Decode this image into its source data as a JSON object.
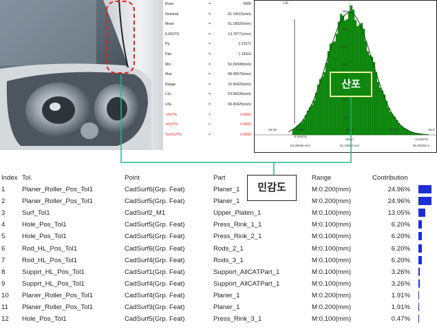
{
  "stats": [
    {
      "label": "Runs",
      "value": "5000",
      "red": false
    },
    {
      "label": "Nominal",
      "value": "61.16515(mm)",
      "red": false
    },
    {
      "label": "Mean",
      "value": "61.18920(mm)",
      "red": false
    },
    {
      "label": "6.00STD",
      "value": "13.79771(mm)",
      "red": false
    },
    {
      "label": "Pp",
      "value": "1.21571",
      "red": false
    },
    {
      "label": "Ppk",
      "value": "1.18110",
      "red": false
    },
    {
      "label": "Min",
      "value": "52.09349(mm)",
      "red": false
    },
    {
      "label": "Max",
      "value": "68.99570(mm)",
      "red": false
    },
    {
      "label": "Range",
      "value": "16.90420(mm)",
      "red": false
    },
    {
      "label": "LSL",
      "value": "53.06634(mm)",
      "red": false
    },
    {
      "label": "USL",
      "value": "69.80425(mm)",
      "red": false
    },
    {
      "label": "-OUT%",
      "value": "0.0000",
      "red": true
    },
    {
      "label": "+OUT%",
      "value": "0.0000",
      "red": true
    },
    {
      "label": "Tol-OUT%",
      "value": "0.0000",
      "red": true
    }
  ],
  "stats_eq": "=",
  "histogram": {
    "lsl_label": "LSL",
    "y_ticks": [
      "50",
      "100",
      "150",
      "200",
      "250",
      "300",
      "350"
    ],
    "x_ticks": [
      "49.00",
      "54.00",
      "59.00",
      "64.00",
      "69.0"
    ],
    "left_marker": {
      "line1": "-3.00STD",
      "line2": "54.29535 mm"
    },
    "mean_marker": {
      "line1": "Mean",
      "line2": "61.18920 mm"
    },
    "right_marker": {
      "line1": "+3.00STD",
      "line2": "68.09305 m"
    }
  },
  "annotations": {
    "spread": "산포",
    "sensitivity": "민감도"
  },
  "table": {
    "headers": {
      "index": "Index",
      "tol": "Tol.",
      "point": "Point",
      "part": "Part",
      "range": "Range",
      "contribution": "Contribution"
    },
    "rows": [
      {
        "index": "1",
        "tol": "Planer_Roller_Pos_Tol1",
        "point": "CadSurf6(Grp. Feat)",
        "part": "Planer_1",
        "range": "M:0.200(mm)",
        "contribution": "24.96%",
        "pct": 24.96
      },
      {
        "index": "2",
        "tol": "Planer_Roller_Pos_Tol1",
        "point": "CadSurf5(Grp. Feat)",
        "part": "Planer_1",
        "range": "M:0.200(mm)",
        "contribution": "24.96%",
        "pct": 24.96
      },
      {
        "index": "3",
        "tol": "Surf_Tol1",
        "point": "CadSurf2_M1",
        "part": "Upper_Platen_1",
        "range": "M:0.100(mm)",
        "contribution": "13.05%",
        "pct": 13.05
      },
      {
        "index": "4",
        "tol": "Hole_Pos_Tol1",
        "point": "CadSurf5(Grp. Feat)",
        "part": "Press_Rink_1_1",
        "range": "M:0.100(mm)",
        "contribution": "6.20%",
        "pct": 6.2
      },
      {
        "index": "5",
        "tol": "Hole_Pos_Tol1",
        "point": "CadSurf5(Grp. Feat)",
        "part": "Press_Rink_2_1",
        "range": "M:0.100(mm)",
        "contribution": "6.20%",
        "pct": 6.2
      },
      {
        "index": "6",
        "tol": "Rod_HL_Pos_Tol1",
        "point": "CadSurf6(Grp. Feat)",
        "part": "Rods_2_1",
        "range": "M:0.100(mm)",
        "contribution": "6.20%",
        "pct": 6.2
      },
      {
        "index": "7",
        "tol": "Rod_HL_Pos_Tol1",
        "point": "CadSurf4(Grp. Feat)",
        "part": "Rods_3_1",
        "range": "M:0.100(mm)",
        "contribution": "6.20%",
        "pct": 6.2
      },
      {
        "index": "8",
        "tol": "Supprt_HL_Pos_Tol1",
        "point": "CadSurf1(Grp. Feat)",
        "part": "Support_AllCATPart_1",
        "range": "M:0.100(mm)",
        "contribution": "3.26%",
        "pct": 3.26
      },
      {
        "index": "9",
        "tol": "Supprt_HL_Pos_Tol1",
        "point": "CadSurf4(Grp. Feat)",
        "part": "Support_AllCATPart_1",
        "range": "M:0.100(mm)",
        "contribution": "3.26%",
        "pct": 3.26
      },
      {
        "index": "10",
        "tol": "Planer_Roller_Pos_Tol1",
        "point": "CadSurf4(Grp. Feat)",
        "part": "Planer_1",
        "range": "M:0.200(mm)",
        "contribution": "1.91%",
        "pct": 1.91
      },
      {
        "index": "11",
        "tol": "Planer_Roller_Pos_Tol1",
        "point": "CadSurf3(Grp. Feat)",
        "part": "Planer_1",
        "range": "M:0.200(mm)",
        "contribution": "1.91%",
        "pct": 1.91
      },
      {
        "index": "12",
        "tol": "Hole_Pos_Tol1",
        "point": "CadSurf5(Grp. Feat)",
        "part": "Press_Rink_3_1",
        "range": "M:0.100(mm)",
        "contribution": "0.47%",
        "pct": 0.47
      }
    ]
  },
  "colors": {
    "bar": "#1c2fd6",
    "histogram_fill": "#119111",
    "connector": "#22b58a",
    "highlight_box": "#e02020"
  }
}
